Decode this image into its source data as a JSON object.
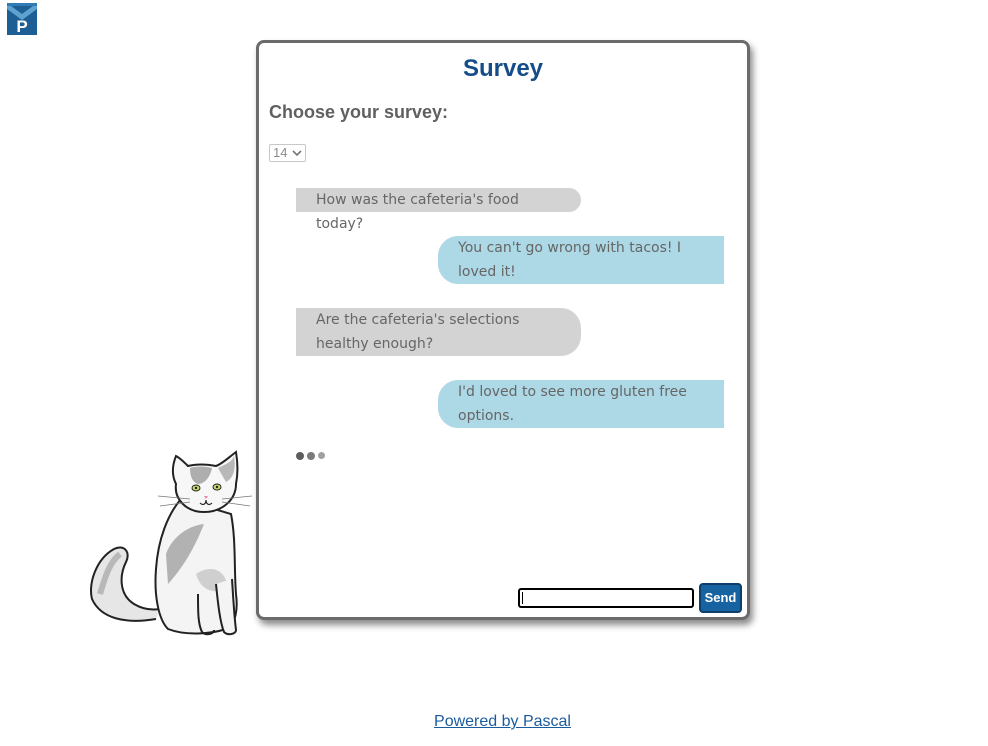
{
  "app": {
    "logo_letter": "P",
    "logo_colors": [
      "#1d5f95",
      "#5ea3cf"
    ]
  },
  "survey": {
    "title": "Survey",
    "choose_label": "Choose your survey:",
    "selected_survey": "14"
  },
  "messages": [
    {
      "side": "left",
      "text": "How was the cafeteria's food today?"
    },
    {
      "side": "right",
      "text": "You can't go wrong with tacos! I loved it!"
    },
    {
      "side": "left",
      "text": "Are the cafeteria's selections healthy enough?"
    },
    {
      "side": "right",
      "text": "I'd loved to see more gluten free options."
    }
  ],
  "typing_indicator": {
    "colors": [
      "#5e5e5e",
      "#7b7b7b",
      "#a0a0a0"
    ]
  },
  "composer": {
    "input_value": "",
    "send_label": "Send"
  },
  "footer": {
    "powered_by": "Powered by Pascal"
  },
  "colors": {
    "title": "#154c8a",
    "bubble_left": "#d3d3d3",
    "bubble_right": "#add8e6",
    "send_button": "#1762a0"
  }
}
